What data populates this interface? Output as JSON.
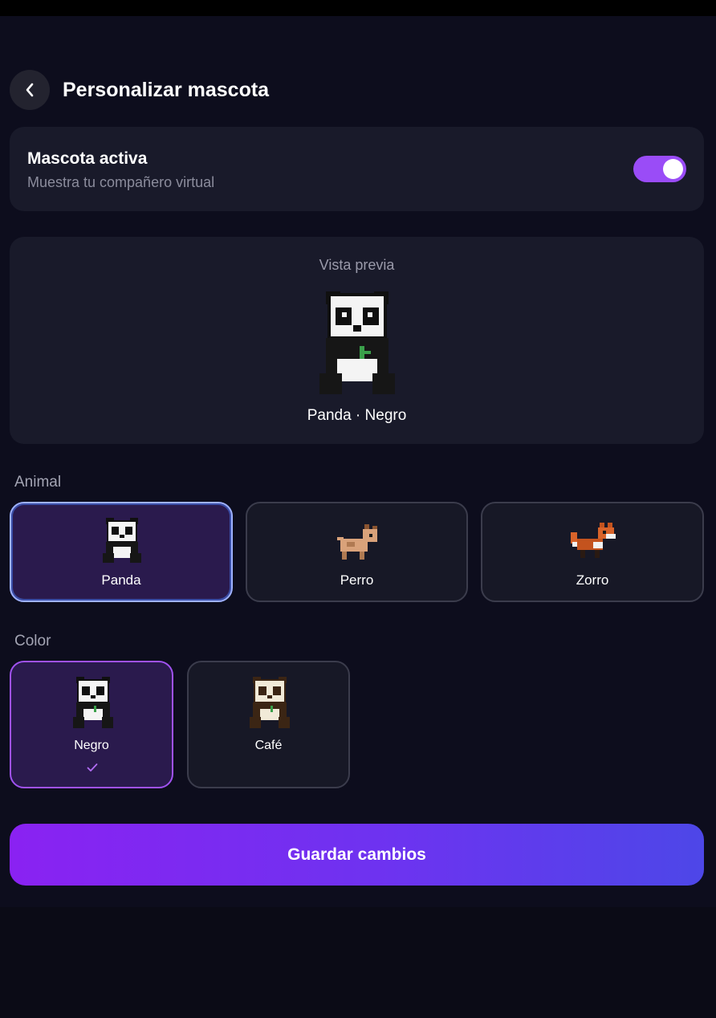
{
  "header": {
    "title": "Personalizar mascota",
    "back_icon": "chevron-left-icon"
  },
  "toggle": {
    "title": "Mascota activa",
    "subtitle": "Muestra tu compañero virtual",
    "enabled": true
  },
  "preview": {
    "label": "Vista previa",
    "name": "Panda · Negro"
  },
  "animal_section": {
    "label": "Animal",
    "options": [
      {
        "label": "Panda",
        "selected": true
      },
      {
        "label": "Perro",
        "selected": false
      },
      {
        "label": "Zorro",
        "selected": false
      }
    ]
  },
  "color_section": {
    "label": "Color",
    "options": [
      {
        "label": "Negro",
        "selected": true
      },
      {
        "label": "Café",
        "selected": false
      }
    ]
  },
  "save_button": {
    "label": "Guardar cambios"
  },
  "colors": {
    "accent": "#9a4cf7",
    "background": "#0d0d1d",
    "card": "#191a2a"
  }
}
